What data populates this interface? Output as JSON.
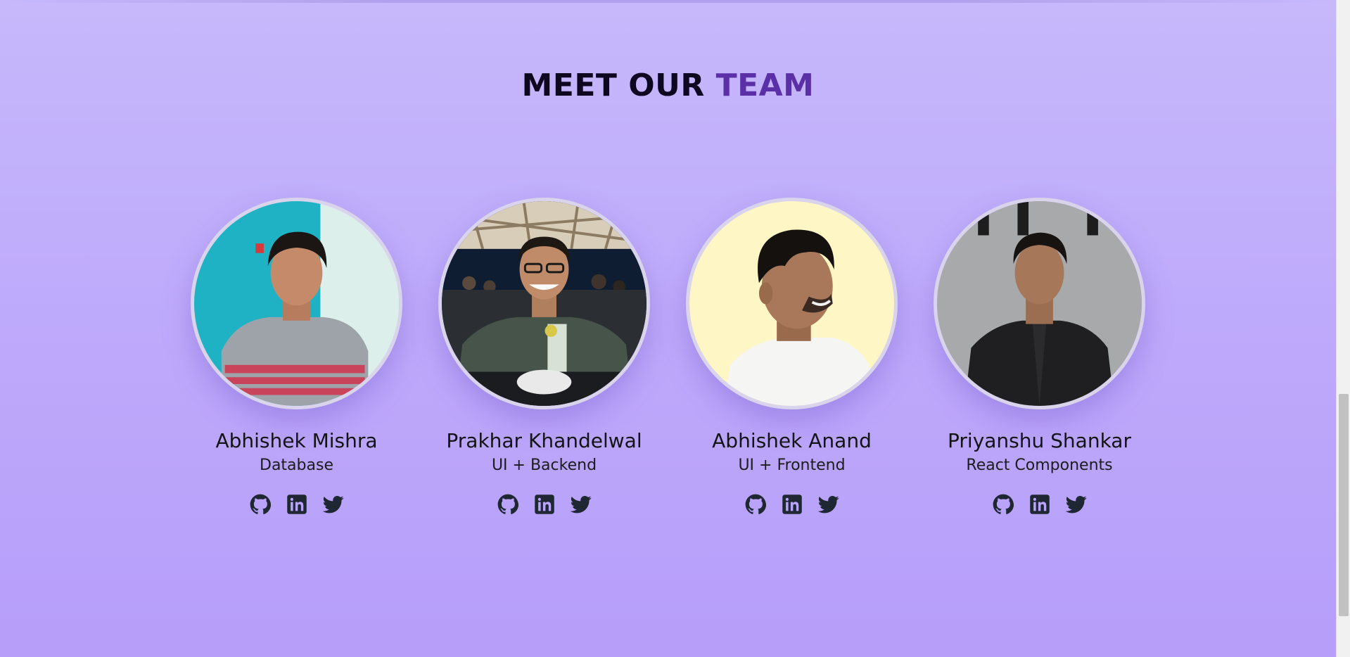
{
  "colors": {
    "accent": "#5b2fa6",
    "icon": "#1f2733",
    "background": "#bda8fb"
  },
  "section": {
    "title_main": "MEET OUR ",
    "title_accent": "TEAM"
  },
  "team": [
    {
      "name": "Abhishek Mishra",
      "role": "Database",
      "photo": "photo of person in grey athletic t-shirt against teal wall",
      "socials": [
        "github-icon",
        "linkedin-icon",
        "twitter-icon"
      ]
    },
    {
      "name": "Prakhar Khandelwal",
      "role": "UI + Backend",
      "photo": "photo of smiling person with glasses at a restaurant table",
      "socials": [
        "github-icon",
        "linkedin-icon",
        "twitter-icon"
      ]
    },
    {
      "name": "Abhishek Anand",
      "role": "UI + Frontend",
      "photo": "photo of person looking sideways against pale yellow background",
      "socials": [
        "github-icon",
        "linkedin-icon",
        "twitter-icon"
      ]
    },
    {
      "name": "Priyanshu Shankar",
      "role": "React Components",
      "photo": "photo of person in black shirt against grey wall",
      "socials": [
        "github-icon",
        "linkedin-icon",
        "twitter-icon"
      ]
    }
  ]
}
